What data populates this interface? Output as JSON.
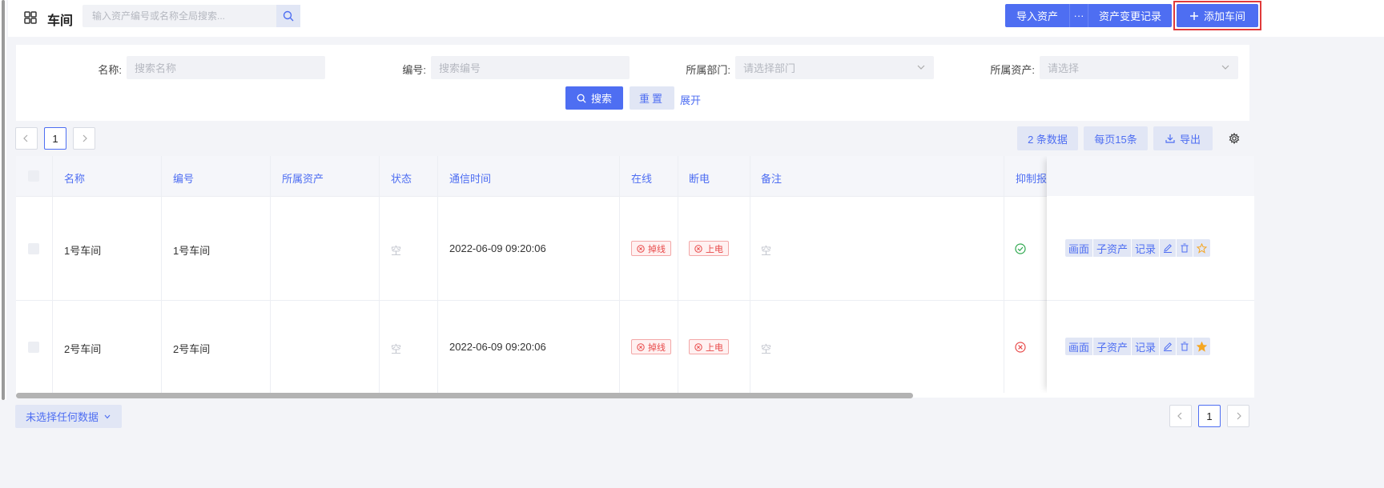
{
  "header": {
    "title": "车间",
    "search_placeholder": "输入资产编号或名称全局搜索...",
    "buttons": {
      "import": "导入资产",
      "more": "···",
      "changelog": "资产变更记录",
      "add": "添加车间"
    }
  },
  "filters": {
    "name": {
      "label": "名称:",
      "placeholder": "搜索名称"
    },
    "code": {
      "label": "编号:",
      "placeholder": "搜索编号"
    },
    "dept": {
      "label": "所属部门:",
      "placeholder": "请选择部门"
    },
    "asset": {
      "label": "所属资产:",
      "placeholder": "请选择"
    },
    "search_label": "搜索",
    "reset_label": "重置",
    "expand_label": "展开"
  },
  "toolbar": {
    "page": "1",
    "count": "2 条数据",
    "per_page": "每页15条",
    "export": "导出"
  },
  "table": {
    "columns": [
      "名称",
      "编号",
      "所属资产",
      "状态",
      "通信时间",
      "在线",
      "断电",
      "备注",
      "抑制报"
    ],
    "rows": [
      {
        "name": "1号车间",
        "code": "1号车间",
        "asset": "",
        "status": "空",
        "comm_time": "2022-06-09 09:20:06",
        "online": "掉线",
        "power": "上电",
        "remark": "空",
        "suppress": "ok",
        "starred": false
      },
      {
        "name": "2号车间",
        "code": "2号车间",
        "asset": "",
        "status": "空",
        "comm_time": "2022-06-09 09:20:06",
        "online": "掉线",
        "power": "上电",
        "remark": "空",
        "suppress": "error",
        "starred": true
      }
    ],
    "actions": {
      "view": "画面",
      "sub": "子资产",
      "log": "记录"
    }
  },
  "footer": {
    "selection": "未选择任何数据",
    "page": "1"
  },
  "colors": {
    "primary": "#4e6ef2",
    "primary_light": "#e1e6f5",
    "danger": "#e84a4a",
    "success": "#2fa84f",
    "star": "#f5a623"
  }
}
